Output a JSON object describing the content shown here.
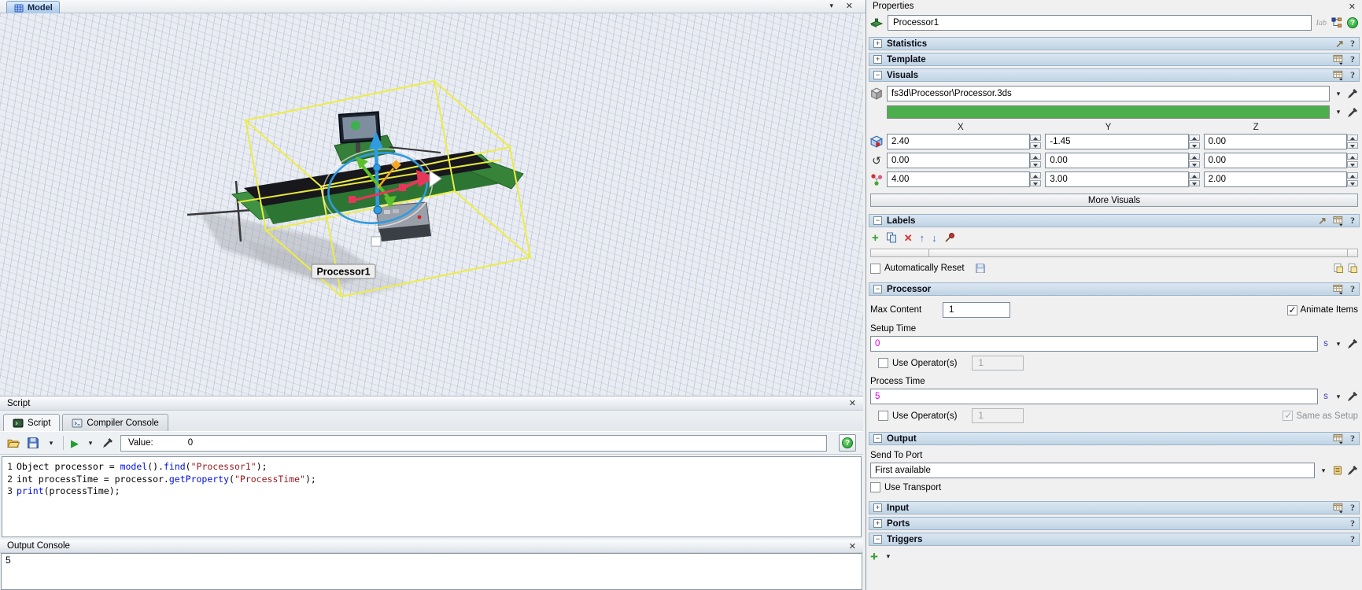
{
  "model_view": {
    "tab_label": "Model",
    "object_label": "Processor1"
  },
  "script": {
    "panel_title": "Script",
    "tabs": [
      "Script",
      "Compiler Console"
    ],
    "value_label": "Value:",
    "value": "0",
    "code_lines": [
      {
        "num": "1",
        "segments": [
          [
            "Object processor = ",
            "pl"
          ],
          [
            "model",
            "fn"
          ],
          [
            "().",
            "pl"
          ],
          [
            "find",
            "fn"
          ],
          [
            "(",
            "pl"
          ],
          [
            "\"Processor1\"",
            "st"
          ],
          [
            ");",
            "pl"
          ]
        ]
      },
      {
        "num": "2",
        "segments": [
          [
            "int processTime = processor.",
            "pl"
          ],
          [
            "getProperty",
            "fn"
          ],
          [
            "(",
            "pl"
          ],
          [
            "\"ProcessTime\"",
            "st"
          ],
          [
            ");",
            "pl"
          ]
        ]
      },
      {
        "num": "3",
        "segments": [
          [
            "print",
            "fn"
          ],
          [
            "(processTime);",
            "pl"
          ]
        ]
      }
    ]
  },
  "output_console": {
    "title": "Output Console",
    "text": "5"
  },
  "properties": {
    "title": "Properties",
    "name_value": "Processor1",
    "statistics": {
      "title": "Statistics"
    },
    "template": {
      "title": "Template"
    },
    "visuals": {
      "title": "Visuals",
      "shape_path": "fs3d\\Processor\\Processor.3ds",
      "color_hex": "#4cae4c",
      "axis": [
        "X",
        "Y",
        "Z"
      ],
      "position": [
        "2.40",
        "-1.45",
        "0.00"
      ],
      "rotation": [
        "0.00",
        "0.00",
        "0.00"
      ],
      "size": [
        "4.00",
        "3.00",
        "2.00"
      ],
      "more_visuals_label": "More Visuals"
    },
    "labels": {
      "title": "Labels",
      "auto_reset_label": "Automatically Reset",
      "auto_reset_checked": false
    },
    "processor": {
      "title": "Processor",
      "max_content_label": "Max Content",
      "max_content_value": "1",
      "animate_items_label": "Animate Items",
      "animate_items_checked": true,
      "setup_time_label": "Setup Time",
      "setup_time_value": "0",
      "setup_time_unit": "s",
      "setup_use_operators_label": "Use Operator(s)",
      "setup_use_operators_checked": false,
      "setup_operators_value": "1",
      "process_time_label": "Process Time",
      "process_time_value": "5",
      "process_time_unit": "s",
      "process_use_operators_label": "Use Operator(s)",
      "process_use_operators_checked": false,
      "process_operators_value": "1",
      "same_as_setup_label": "Same as Setup",
      "same_as_setup_checked": true
    },
    "output": {
      "title": "Output",
      "send_to_port_label": "Send To Port",
      "send_to_port_value": "First available",
      "use_transport_label": "Use Transport",
      "use_transport_checked": false
    },
    "input": {
      "title": "Input"
    },
    "ports": {
      "title": "Ports"
    },
    "triggers": {
      "title": "Triggers"
    }
  },
  "icons": {
    "close": "✕",
    "dropdown": "▾",
    "help": "?",
    "expand": "+",
    "collapse": "−",
    "pin_arrow": "↗",
    "add": "+",
    "delete": "✕",
    "move_up": "↑",
    "move_down": "↓",
    "rotate": "↺",
    "play": "▶",
    "text_cursor": "Iab"
  }
}
